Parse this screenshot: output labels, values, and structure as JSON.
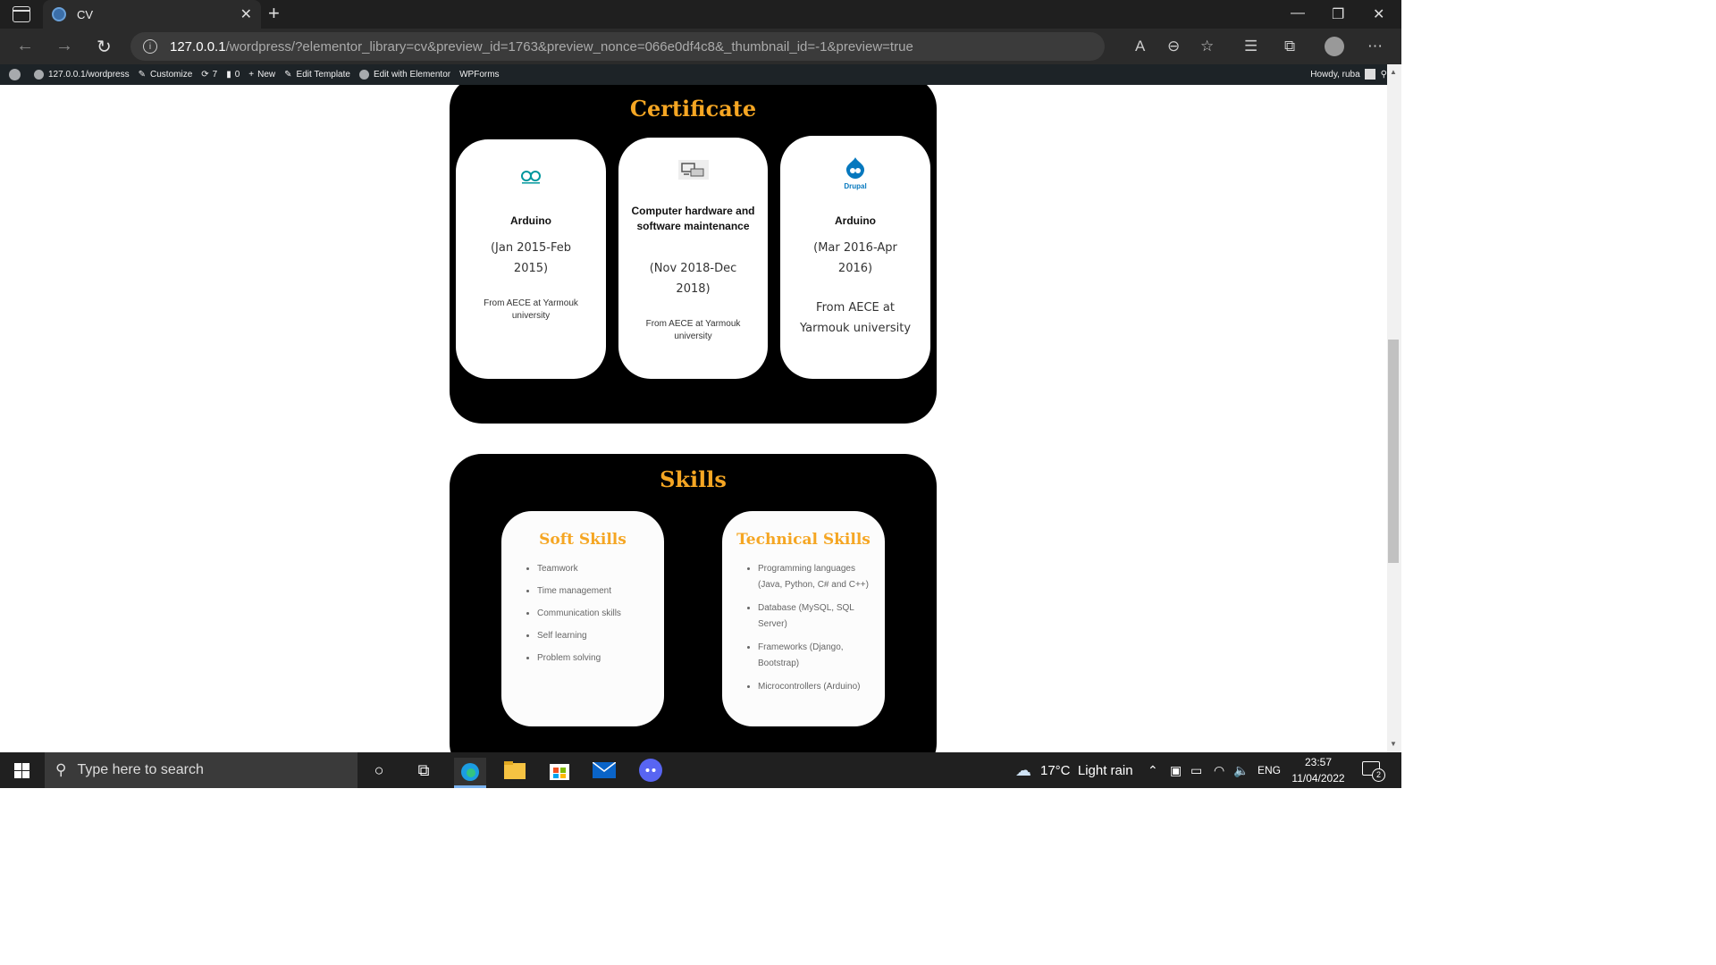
{
  "browser": {
    "tab_title": "CV",
    "url_host": "127.0.0.1",
    "url_rest": "/wordpress/?elementor_library=cv&preview_id=1763&preview_nonce=066e0df4c8&_thumbnail_id=-1&preview=true"
  },
  "wp_admin_bar": {
    "site": "127.0.0.1/wordpress",
    "customize": "Customize",
    "updates_count": "7",
    "comments_count": "0",
    "new": "New",
    "edit_template": "Edit Template",
    "edit_with_elementor": "Edit with Elementor",
    "wpforms": "WPForms",
    "howdy": "Howdy, ruba"
  },
  "certificate": {
    "title": "Certificate",
    "cards": [
      {
        "logo": "arduino-logo",
        "name": "Arduino",
        "date": "(Jan 2015-Feb 2015)",
        "from": "From AECE at Yarmouk university"
      },
      {
        "logo": "hardware-logo",
        "name": "Computer hardware and software maintenance",
        "date": "(Nov 2018-Dec 2018)",
        "from": "From AECE at Yarmouk university"
      },
      {
        "logo": "drupal-logo",
        "logo_text": "Drupal",
        "name": "Arduino",
        "date": "(Mar 2016-Apr 2016)",
        "from": "From AECE at Yarmouk university"
      }
    ]
  },
  "skills": {
    "title": "Skills",
    "soft": {
      "title": "Soft Skills",
      "items": [
        "Teamwork",
        "Time management",
        "Communication skills",
        "Self learning",
        "Problem solving"
      ]
    },
    "technical": {
      "title": "Technical Skills",
      "items": [
        "Programming languages (Java, Python, C# and C++)",
        "Database (MySQL, SQL Server)",
        "Frameworks (Django, Bootstrap)",
        "Microcontrollers (Arduino)"
      ]
    }
  },
  "taskbar": {
    "search_placeholder": "Type here to search",
    "weather": "17°C  Light rain",
    "language": "ENG",
    "time": "23:57",
    "date": "11/04/2022",
    "notification_count": "2"
  },
  "colors": {
    "accent_gold": "#f5a623",
    "section_bg": "#000000",
    "arduino_teal": "#00979d",
    "drupal_blue": "#0678be"
  }
}
